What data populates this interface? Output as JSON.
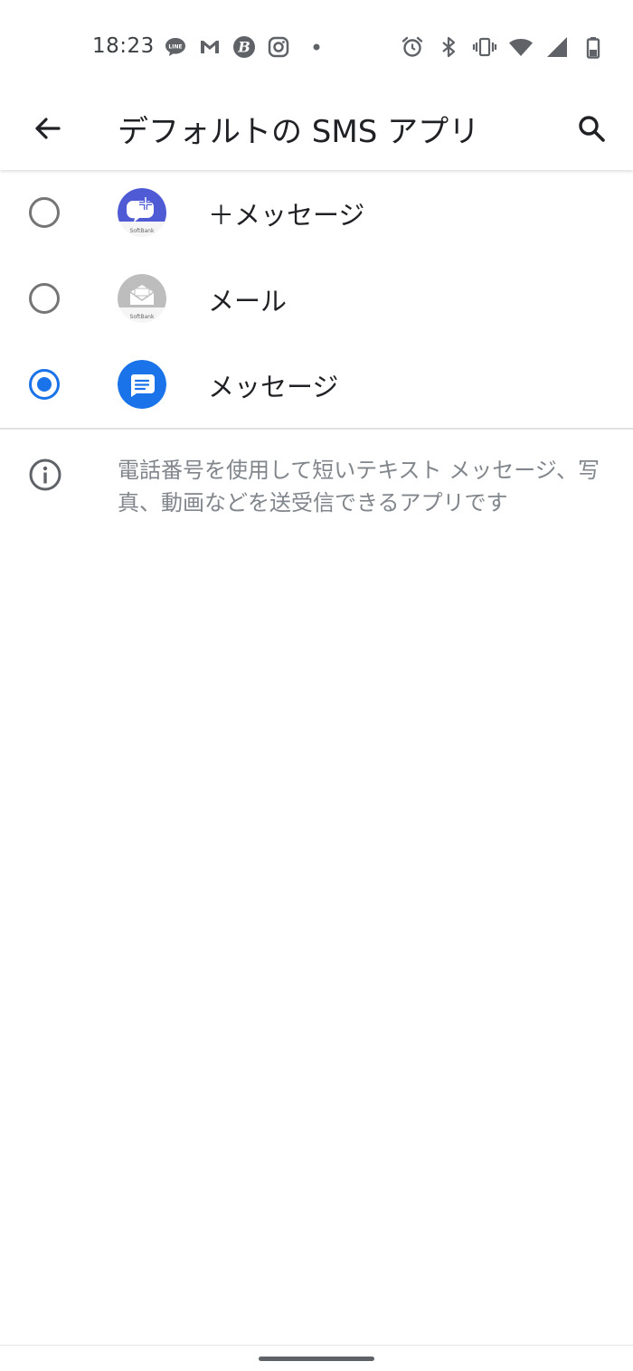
{
  "status_bar": {
    "time": "18:23",
    "notification_icons": [
      "line-icon",
      "gmail-icon",
      "b-app-icon",
      "instagram-icon",
      "more-dot-icon"
    ],
    "system_icons": [
      "alarm-icon",
      "bluetooth-icon",
      "vibrate-icon",
      "wifi-icon",
      "cell-signal-icon",
      "battery-icon"
    ]
  },
  "app_bar": {
    "title": "デフォルトの SMS アプリ",
    "back_icon": "arrow-back-icon",
    "search_icon": "search-icon"
  },
  "apps": [
    {
      "label": "＋メッセージ",
      "selected": false,
      "icon": "plus-message-app-icon",
      "icon_color": "#4f5bd5",
      "icon_caption": "SoftBank"
    },
    {
      "label": "メール",
      "selected": false,
      "icon": "mail-app-icon",
      "icon_color": "#bdbdbd",
      "icon_caption": "SoftBank"
    },
    {
      "label": "メッセージ",
      "selected": true,
      "icon": "messages-app-icon",
      "icon_color": "#1a73e8"
    }
  ],
  "info": {
    "icon": "info-icon",
    "text": "電話番号を使用して短いテキスト メッセージ、写真、動画などを送受信できるアプリです"
  },
  "colors": {
    "accent": "#1a73e8",
    "radio_off": "#757575",
    "secondary_text": "#80868b"
  }
}
